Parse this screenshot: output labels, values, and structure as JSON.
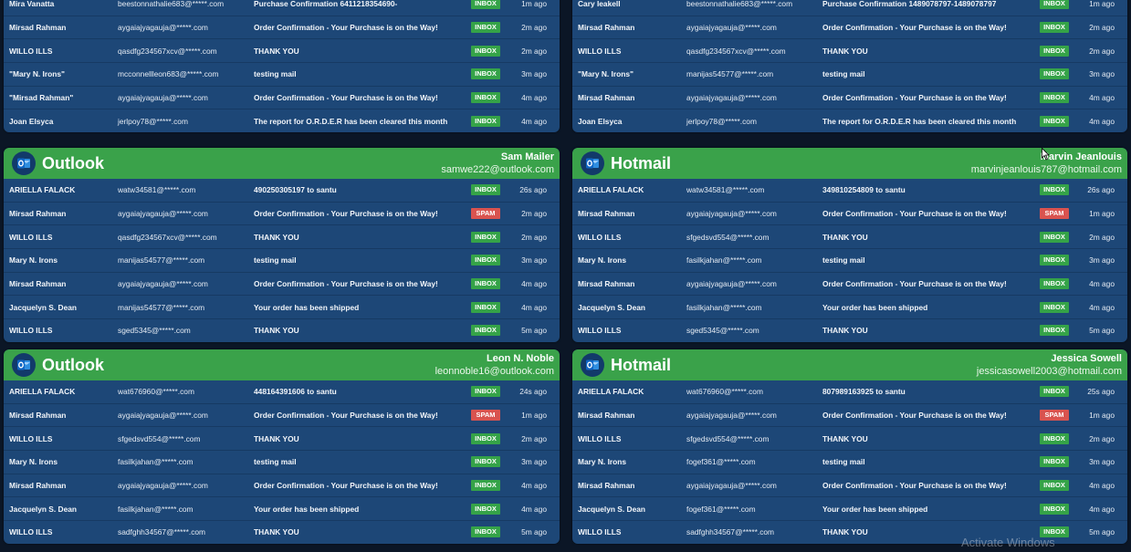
{
  "panels": [
    {
      "header": null,
      "rows": [
        {
          "sender": "Mira Vanatta",
          "email": "beestonnathalie683@*****.com",
          "subject": "Purchase Confirmation 6411218354690-",
          "status": "INBOX",
          "time": "1m ago"
        },
        {
          "sender": "Mirsad Rahman",
          "email": "aygaiajyagauja@*****.com",
          "subject": "Order Confirmation - Your Purchase is on the Way!",
          "status": "INBOX",
          "time": "2m ago"
        },
        {
          "sender": "WILLO ILLS",
          "email": "qasdfg234567xcv@*****.com",
          "subject": "THANK YOU",
          "status": "INBOX",
          "time": "2m ago"
        },
        {
          "sender": "\"Mary N. Irons\"",
          "email": "mcconnellleon683@*****.com",
          "subject": "testing mail",
          "status": "INBOX",
          "time": "3m ago"
        },
        {
          "sender": "\"Mirsad Rahman\"",
          "email": "aygaiajyagauja@*****.com",
          "subject": "Order Confirmation - Your Purchase is on the Way!",
          "status": "INBOX",
          "time": "4m ago"
        },
        {
          "sender": "Joan Elsyca",
          "email": "jerlpoy78@*****.com",
          "subject": "The report for O.R.D.E.R has been cleared this month",
          "status": "INBOX",
          "time": "4m ago"
        }
      ]
    },
    {
      "header": null,
      "rows": [
        {
          "sender": "Cary Ieakell",
          "email": "beestonnathalie683@*****.com",
          "subject": "Purchase Confirmation 1489078797-1489078797",
          "status": "INBOX",
          "time": "1m ago"
        },
        {
          "sender": "Mirsad Rahman",
          "email": "aygaiajyagauja@*****.com",
          "subject": "Order Confirmation - Your Purchase is on the Way!",
          "status": "INBOX",
          "time": "2m ago"
        },
        {
          "sender": "WILLO ILLS",
          "email": "qasdfg234567xcv@*****.com",
          "subject": "THANK YOU",
          "status": "INBOX",
          "time": "2m ago"
        },
        {
          "sender": "\"Mary N. Irons\"",
          "email": "manijas54577@*****.com",
          "subject": "testing mail",
          "status": "INBOX",
          "time": "3m ago"
        },
        {
          "sender": "Mirsad Rahman",
          "email": "aygaiajyagauja@*****.com",
          "subject": "Order Confirmation - Your Purchase is on the Way!",
          "status": "INBOX",
          "time": "4m ago"
        },
        {
          "sender": "Joan Elsyca",
          "email": "jerlpoy78@*****.com",
          "subject": "The report for O.R.D.E.R has been cleared this month",
          "status": "INBOX",
          "time": "4m ago"
        }
      ]
    },
    {
      "header": {
        "brand": "Outlook",
        "name": "Sam Mailer",
        "email": "samwe222@outlook.com"
      },
      "rows": [
        {
          "sender": "ARIELLA FALACK",
          "email": "watw34581@*****.com",
          "subject": "490250305197 to santu",
          "status": "INBOX",
          "time": "26s ago"
        },
        {
          "sender": "Mirsad Rahman",
          "email": "aygaiajyagauja@*****.com",
          "subject": "Order Confirmation - Your Purchase is on the Way!",
          "status": "SPAM",
          "time": "2m ago"
        },
        {
          "sender": "WILLO ILLS",
          "email": "qasdfg234567xcv@*****.com",
          "subject": "THANK YOU",
          "status": "INBOX",
          "time": "2m ago"
        },
        {
          "sender": "Mary N. Irons",
          "email": "manijas54577@*****.com",
          "subject": "testing mail",
          "status": "INBOX",
          "time": "3m ago"
        },
        {
          "sender": "Mirsad Rahman",
          "email": "aygaiajyagauja@*****.com",
          "subject": "Order Confirmation - Your Purchase is on the Way!",
          "status": "INBOX",
          "time": "4m ago"
        },
        {
          "sender": "Jacquelyn S. Dean",
          "email": "manijas54577@*****.com",
          "subject": "Your order has been shipped",
          "status": "INBOX",
          "time": "4m ago"
        },
        {
          "sender": "WILLO ILLS",
          "email": "sged5345@*****.com",
          "subject": "THANK YOU",
          "status": "INBOX",
          "time": "5m ago"
        }
      ]
    },
    {
      "header": {
        "brand": "Hotmail",
        "name": "Marvin Jeanlouis",
        "email": "marvinjeanlouis787@hotmail.com"
      },
      "rows": [
        {
          "sender": "ARIELLA FALACK",
          "email": "watw34581@*****.com",
          "subject": "349810254809 to santu",
          "status": "INBOX",
          "time": "26s ago"
        },
        {
          "sender": "Mirsad Rahman",
          "email": "aygaiajyagauja@*****.com",
          "subject": "Order Confirmation - Your Purchase is on the Way!",
          "status": "SPAM",
          "time": "1m ago"
        },
        {
          "sender": "WILLO ILLS",
          "email": "sfgedsvd554@*****.com",
          "subject": "THANK YOU",
          "status": "INBOX",
          "time": "2m ago"
        },
        {
          "sender": "Mary N. Irons",
          "email": "fasilkjahan@*****.com",
          "subject": "testing mail",
          "status": "INBOX",
          "time": "3m ago"
        },
        {
          "sender": "Mirsad Rahman",
          "email": "aygaiajyagauja@*****.com",
          "subject": "Order Confirmation - Your Purchase is on the Way!",
          "status": "INBOX",
          "time": "4m ago"
        },
        {
          "sender": "Jacquelyn S. Dean",
          "email": "fasilkjahan@*****.com",
          "subject": "Your order has been shipped",
          "status": "INBOX",
          "time": "4m ago"
        },
        {
          "sender": "WILLO ILLS",
          "email": "sged5345@*****.com",
          "subject": "THANK YOU",
          "status": "INBOX",
          "time": "5m ago"
        }
      ]
    },
    {
      "header": {
        "brand": "Outlook",
        "name": "Leon N. Noble",
        "email": "leonnoble16@outlook.com"
      },
      "rows": [
        {
          "sender": "ARIELLA FALACK",
          "email": "wat676960@*****.com",
          "subject": "448164391606 to santu",
          "status": "INBOX",
          "time": "24s ago"
        },
        {
          "sender": "Mirsad Rahman",
          "email": "aygaiajyagauja@*****.com",
          "subject": "Order Confirmation - Your Purchase is on the Way!",
          "status": "SPAM",
          "time": "1m ago"
        },
        {
          "sender": "WILLO ILLS",
          "email": "sfgedsvd554@*****.com",
          "subject": "THANK YOU",
          "status": "INBOX",
          "time": "2m ago"
        },
        {
          "sender": "Mary N. Irons",
          "email": "fasilkjahan@*****.com",
          "subject": "testing mail",
          "status": "INBOX",
          "time": "3m ago"
        },
        {
          "sender": "Mirsad Rahman",
          "email": "aygaiajyagauja@*****.com",
          "subject": "Order Confirmation - Your Purchase is on the Way!",
          "status": "INBOX",
          "time": "4m ago"
        },
        {
          "sender": "Jacquelyn S. Dean",
          "email": "fasilkjahan@*****.com",
          "subject": "Your order has been shipped",
          "status": "INBOX",
          "time": "4m ago"
        },
        {
          "sender": "WILLO ILLS",
          "email": "sadfghh34567@*****.com",
          "subject": "THANK YOU",
          "status": "INBOX",
          "time": "5m ago"
        }
      ]
    },
    {
      "header": {
        "brand": "Hotmail",
        "name": "Jessica Sowell",
        "email": "jessicasowell2003@hotmail.com"
      },
      "rows": [
        {
          "sender": "ARIELLA FALACK",
          "email": "wat676960@*****.com",
          "subject": "807989163925 to santu",
          "status": "INBOX",
          "time": "25s ago"
        },
        {
          "sender": "Mirsad Rahman",
          "email": "aygaiajyagauja@*****.com",
          "subject": "Order Confirmation - Your Purchase is on the Way!",
          "status": "SPAM",
          "time": "1m ago"
        },
        {
          "sender": "WILLO ILLS",
          "email": "sfgedsvd554@*****.com",
          "subject": "THANK YOU",
          "status": "INBOX",
          "time": "2m ago"
        },
        {
          "sender": "Mary N. Irons",
          "email": "fogef361@*****.com",
          "subject": "testing mail",
          "status": "INBOX",
          "time": "3m ago"
        },
        {
          "sender": "Mirsad Rahman",
          "email": "aygaiajyagauja@*****.com",
          "subject": "Order Confirmation - Your Purchase is on the Way!",
          "status": "INBOX",
          "time": "4m ago"
        },
        {
          "sender": "Jacquelyn S. Dean",
          "email": "fogef361@*****.com",
          "subject": "Your order has been shipped",
          "status": "INBOX",
          "time": "4m ago"
        },
        {
          "sender": "WILLO ILLS",
          "email": "sadfghh34567@*****.com",
          "subject": "THANK YOU",
          "status": "INBOX",
          "time": "5m ago"
        }
      ]
    }
  ],
  "watermark": "Activate Windows",
  "colors": {
    "header": "#3aa24a",
    "panel": "#1d4777",
    "inbox": "#35a348",
    "spam": "#d9534f"
  },
  "icons": {
    "brand": "outlook-icon",
    "cursor": "mouse-pointer-icon"
  }
}
